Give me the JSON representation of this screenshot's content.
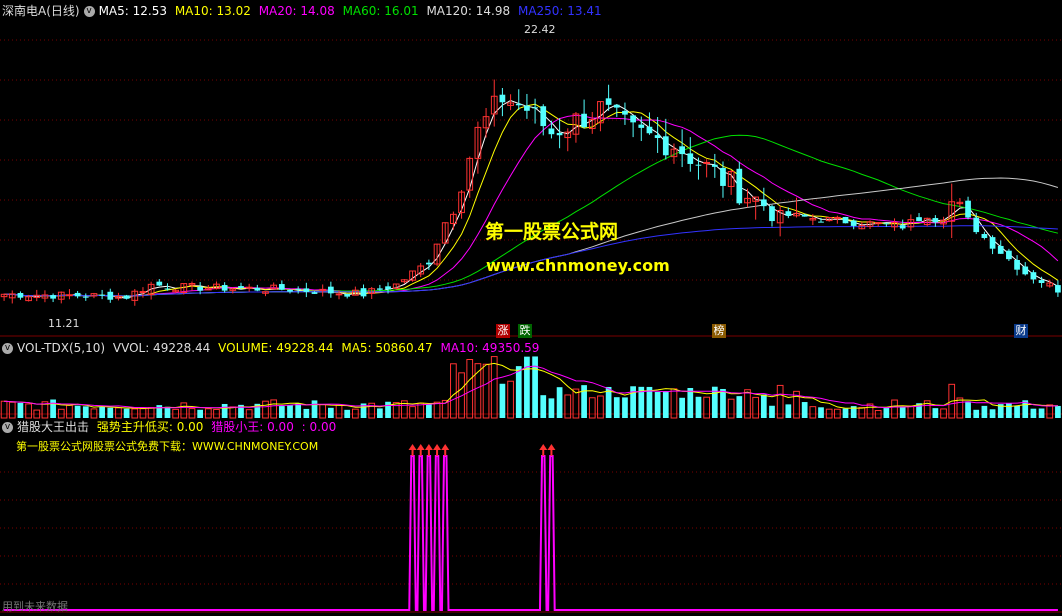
{
  "main_header": {
    "title": "深南电A(日线)",
    "ma5": "MA5: 12.53",
    "ma10": "MA10: 13.02",
    "ma20": "MA20: 14.08",
    "ma60": "MA60: 16.01",
    "ma120": "MA120: 14.98",
    "ma250": "MA250: 13.41"
  },
  "vol_header": {
    "name": "VOL-TDX(5,10)",
    "vvol": "VVOL: 49228.44",
    "volume": "VOLUME: 49228.44",
    "ma5": "MA5: 50860.47",
    "ma10": "MA10: 49350.59"
  },
  "ind_header": {
    "name": "猎股大王出击",
    "strong": "强势主升低买: 0.00",
    "king": "猎股小王: 0.00",
    "extra": ": 0.00",
    "promo": "第一股票公式网股票公式免费下载：WWW.CHNMONEY.COM"
  },
  "watermark": {
    "site_name": "第一股票公式网",
    "url": "www.chnmoney.com"
  },
  "footer_text": "用到未来数据",
  "price_labels": {
    "high": "22.42",
    "low": "11.21"
  },
  "markers": [
    "涨",
    "跌",
    "榜",
    "财"
  ],
  "colors": {
    "bg": "#000000",
    "up": "#ff3232",
    "down": "#54ffff",
    "ma5": "#ffffff",
    "ma10": "#ffff00",
    "ma20": "#ff00ff",
    "ma60": "#00e000",
    "ma120": "#c8c8c8",
    "ma250": "#3232ff",
    "signal": "#ff00ff",
    "grid": "#7a0000"
  },
  "chart_data": [
    {
      "type": "candlestick",
      "title": "深南电A(日线)",
      "y_range": [
        10.5,
        23.3
      ],
      "n_candles": 130,
      "trend_keypoints": [
        [
          0,
          11.6
        ],
        [
          15,
          11.5
        ],
        [
          18,
          12.0
        ],
        [
          22,
          11.9
        ],
        [
          35,
          11.8
        ],
        [
          44,
          11.6
        ],
        [
          48,
          12.0
        ],
        [
          52,
          13.0
        ],
        [
          55,
          15.5
        ],
        [
          58,
          18.5
        ],
        [
          61,
          20.0
        ],
        [
          64,
          19.5
        ],
        [
          67,
          18.5
        ],
        [
          70,
          19.0
        ],
        [
          73,
          19.5
        ],
        [
          77,
          18.5
        ],
        [
          82,
          18.0
        ],
        [
          88,
          16.5
        ],
        [
          95,
          15.0
        ],
        [
          100,
          14.8
        ],
        [
          110,
          14.5
        ],
        [
          116,
          15.5
        ],
        [
          120,
          14.0
        ],
        [
          125,
          12.5
        ],
        [
          129,
          11.8
        ]
      ],
      "high": 22.42,
      "low": 11.21,
      "ma_series": [
        "MA5",
        "MA10",
        "MA20",
        "MA60",
        "MA120",
        "MA250"
      ]
    },
    {
      "type": "bar",
      "title": "VOL-TDX(5,10)",
      "series": [
        {
          "name": "VOLUME"
        },
        {
          "name": "MA5"
        },
        {
          "name": "MA10"
        }
      ],
      "current": {
        "VOLUME": 49228.44,
        "MA5": 50860.47,
        "MA10": 49350.59
      }
    },
    {
      "type": "line",
      "title": "猎股大王出击",
      "signal_bars": [
        50,
        51,
        52,
        53,
        54,
        66,
        67
      ],
      "values_all_zero_except_signals": true
    }
  ]
}
